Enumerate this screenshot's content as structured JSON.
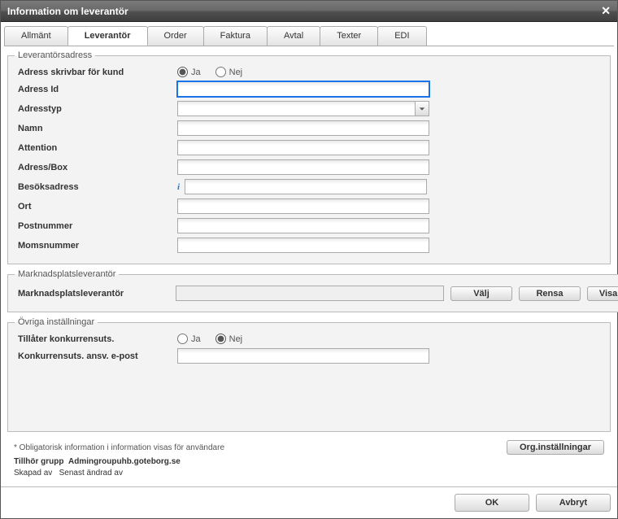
{
  "title": "Information om leverantör",
  "tabs": {
    "t0": "Allmänt",
    "t1": "Leverantör",
    "t2": "Order",
    "t3": "Faktura",
    "t4": "Avtal",
    "t5": "Texter",
    "t6": "EDI"
  },
  "fs1": {
    "legend": "Leverantörsadress",
    "adress_skrivbar_label": "Adress skrivbar för kund",
    "ja": "Ja",
    "nej": "Nej",
    "adress_id_label": "Adress Id",
    "adresstyp_label": "Adresstyp",
    "namn_label": "Namn",
    "attention_label": "Attention",
    "adressbox_label": "Adress/Box",
    "besoksadress_label": "Besöksadress",
    "ort_label": "Ort",
    "postnummer_label": "Postnummer",
    "momsnummer_label": "Momsnummer",
    "adress_id_value": "",
    "adresstyp_value": "",
    "namn_value": "",
    "attention_value": "",
    "adressbox_value": "",
    "besoksadress_value": "",
    "ort_value": "",
    "postnummer_value": "",
    "momsnummer_value": ""
  },
  "fs2": {
    "legend": "Marknadsplatsleverantör",
    "label": "Marknadsplatsleverantör",
    "value": "",
    "valj": "Välj",
    "rensa": "Rensa",
    "visakort": "Visa kort"
  },
  "fs3": {
    "legend": "Övriga inställningar",
    "tillater_label": "Tillåter konkurrensuts.",
    "ja": "Ja",
    "nej": "Nej",
    "epost_label": "Konkurrensuts. ansv. e-post",
    "epost_value": ""
  },
  "footer": {
    "hint": "* Obligatorisk information  i information visas för användare",
    "tillhor_label": "Tillhör grupp",
    "tillhor_value": "Admingroupuhb.goteborg.se",
    "skapad_label": "Skapad av",
    "senast_label": "Senast ändrad av",
    "org_btn": "Org.inställningar"
  },
  "buttons": {
    "ok": "OK",
    "avbryt": "Avbryt"
  }
}
